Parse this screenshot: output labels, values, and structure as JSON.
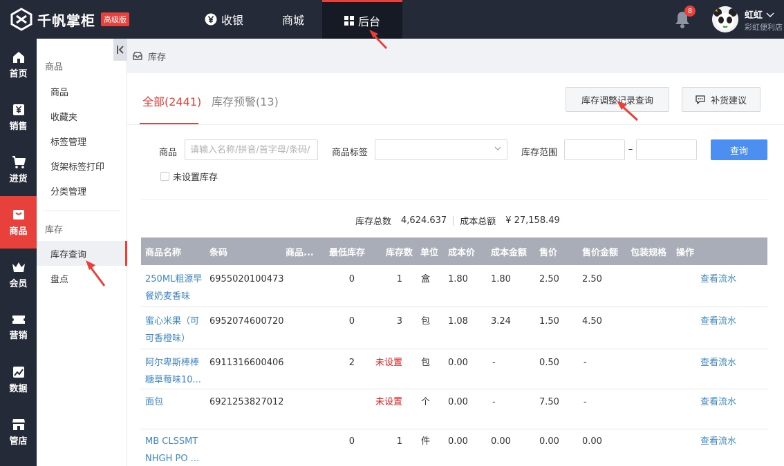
{
  "brand": {
    "name": "千帆掌柜",
    "badge": "高级版"
  },
  "topnav": [
    {
      "label": "收银",
      "icon": "yen-coin-icon"
    },
    {
      "label": "商城",
      "icon": ""
    },
    {
      "label": "后台",
      "icon": "grid-icon",
      "active": true
    }
  ],
  "user": {
    "notifications": "8",
    "name": "虹虹",
    "shop": "彩虹便利店"
  },
  "rail": [
    {
      "label": "首页",
      "icon": "home-icon"
    },
    {
      "label": "销售",
      "icon": "sales-icon"
    },
    {
      "label": "进货",
      "icon": "cart-icon"
    },
    {
      "label": "商品",
      "icon": "goods-icon",
      "active": true
    },
    {
      "label": "会员",
      "icon": "crown-icon"
    },
    {
      "label": "营销",
      "icon": "ticket-icon"
    },
    {
      "label": "数据",
      "icon": "chart-icon"
    },
    {
      "label": "管店",
      "icon": "store-icon"
    }
  ],
  "submenu": {
    "group1": "商品",
    "items1": [
      "商品",
      "收藏夹",
      "标签管理",
      "货架标签打印",
      "分类管理"
    ],
    "group2": "库存",
    "items2": [
      "库存查询",
      "盘点"
    ],
    "active": "库存查询"
  },
  "breadcrumb": "库存",
  "tabs": {
    "all": "全部(2441)",
    "warning": "库存预警(13)"
  },
  "buttons": {
    "adjust_records": "库存调整记录查询",
    "restock": "补货建议",
    "query": "查询"
  },
  "filters": {
    "product_label": "商品",
    "product_placeholder": "请输入名称/拼音/首字母/条码/",
    "tag_label": "商品标签",
    "tag_value": "",
    "range_label": "库存范围",
    "range_dash": "–",
    "range_min": "",
    "range_max": "",
    "unset_label": "未设置库存"
  },
  "summary": {
    "total_stock_label": "库存总数",
    "total_stock": "4,624.637",
    "total_cost_label": "成本总额",
    "total_cost": "¥ 27,158.49"
  },
  "table": {
    "columns": [
      "商品名称",
      "条码",
      "商品...",
      "最低库存",
      "库存数",
      "单位",
      "成本价",
      "成本金额",
      "售价",
      "售价金额",
      "包装规格",
      "操作"
    ],
    "rows": [
      {
        "name": "250ML粗源早餐奶麦香味",
        "barcode": "6955020100473",
        "min_stock": "0",
        "stock": "1",
        "unit": "盒",
        "cost": "1.80",
        "cost_total": "1.80",
        "price": "2.50",
        "price_total": "2.50",
        "action": "查看流水"
      },
      {
        "name": "蜜心米果（可可香橙味）",
        "barcode": "6952074600720",
        "min_stock": "0",
        "stock": "3",
        "unit": "包",
        "cost": "1.08",
        "cost_total": "3.24",
        "price": "1.50",
        "price_total": "4.50",
        "action": "查看流水"
      },
      {
        "name": "阿尔卑斯棒棒糖草莓味10...",
        "barcode": "6911316600406",
        "min_stock": "2",
        "stock": "未设置",
        "unit": "包",
        "cost": "0.00",
        "cost_total": "-",
        "price": "0.50",
        "price_total": "-",
        "action": "查看流水"
      },
      {
        "name": "面包",
        "barcode": "6921253827012",
        "min_stock": "",
        "stock": "未设置",
        "unit": "个",
        "cost": "0.00",
        "cost_total": "-",
        "price": "7.50",
        "price_total": "-",
        "action": "查看流水"
      },
      {
        "name": "MB CLSSMT NHGH PO ...",
        "barcode": "",
        "min_stock": "0",
        "stock": "1",
        "unit": "件",
        "cost": "0.00",
        "cost_total": "0.00",
        "price": "0.00",
        "price_total": "0.00",
        "action": "查看流水"
      }
    ]
  },
  "colors": {
    "accent": "#e8403a",
    "dark": "#252a38",
    "link": "#3f87c9",
    "primary": "#4d8ff0",
    "header": "#a8adb8"
  }
}
